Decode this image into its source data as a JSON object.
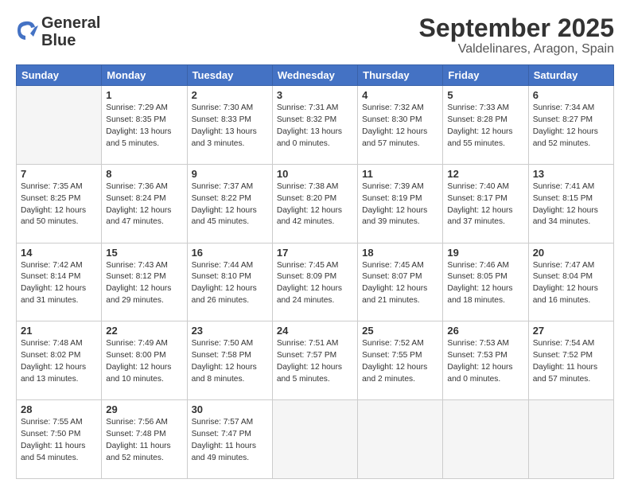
{
  "logo": {
    "line1": "General",
    "line2": "Blue"
  },
  "title": "September 2025",
  "subtitle": "Valdelinares, Aragon, Spain",
  "weekdays": [
    "Sunday",
    "Monday",
    "Tuesday",
    "Wednesday",
    "Thursday",
    "Friday",
    "Saturday"
  ],
  "weeks": [
    [
      {
        "day": "",
        "info": ""
      },
      {
        "day": "1",
        "info": "Sunrise: 7:29 AM\nSunset: 8:35 PM\nDaylight: 13 hours\nand 5 minutes."
      },
      {
        "day": "2",
        "info": "Sunrise: 7:30 AM\nSunset: 8:33 PM\nDaylight: 13 hours\nand 3 minutes."
      },
      {
        "day": "3",
        "info": "Sunrise: 7:31 AM\nSunset: 8:32 PM\nDaylight: 13 hours\nand 0 minutes."
      },
      {
        "day": "4",
        "info": "Sunrise: 7:32 AM\nSunset: 8:30 PM\nDaylight: 12 hours\nand 57 minutes."
      },
      {
        "day": "5",
        "info": "Sunrise: 7:33 AM\nSunset: 8:28 PM\nDaylight: 12 hours\nand 55 minutes."
      },
      {
        "day": "6",
        "info": "Sunrise: 7:34 AM\nSunset: 8:27 PM\nDaylight: 12 hours\nand 52 minutes."
      }
    ],
    [
      {
        "day": "7",
        "info": "Sunrise: 7:35 AM\nSunset: 8:25 PM\nDaylight: 12 hours\nand 50 minutes."
      },
      {
        "day": "8",
        "info": "Sunrise: 7:36 AM\nSunset: 8:24 PM\nDaylight: 12 hours\nand 47 minutes."
      },
      {
        "day": "9",
        "info": "Sunrise: 7:37 AM\nSunset: 8:22 PM\nDaylight: 12 hours\nand 45 minutes."
      },
      {
        "day": "10",
        "info": "Sunrise: 7:38 AM\nSunset: 8:20 PM\nDaylight: 12 hours\nand 42 minutes."
      },
      {
        "day": "11",
        "info": "Sunrise: 7:39 AM\nSunset: 8:19 PM\nDaylight: 12 hours\nand 39 minutes."
      },
      {
        "day": "12",
        "info": "Sunrise: 7:40 AM\nSunset: 8:17 PM\nDaylight: 12 hours\nand 37 minutes."
      },
      {
        "day": "13",
        "info": "Sunrise: 7:41 AM\nSunset: 8:15 PM\nDaylight: 12 hours\nand 34 minutes."
      }
    ],
    [
      {
        "day": "14",
        "info": "Sunrise: 7:42 AM\nSunset: 8:14 PM\nDaylight: 12 hours\nand 31 minutes."
      },
      {
        "day": "15",
        "info": "Sunrise: 7:43 AM\nSunset: 8:12 PM\nDaylight: 12 hours\nand 29 minutes."
      },
      {
        "day": "16",
        "info": "Sunrise: 7:44 AM\nSunset: 8:10 PM\nDaylight: 12 hours\nand 26 minutes."
      },
      {
        "day": "17",
        "info": "Sunrise: 7:45 AM\nSunset: 8:09 PM\nDaylight: 12 hours\nand 24 minutes."
      },
      {
        "day": "18",
        "info": "Sunrise: 7:45 AM\nSunset: 8:07 PM\nDaylight: 12 hours\nand 21 minutes."
      },
      {
        "day": "19",
        "info": "Sunrise: 7:46 AM\nSunset: 8:05 PM\nDaylight: 12 hours\nand 18 minutes."
      },
      {
        "day": "20",
        "info": "Sunrise: 7:47 AM\nSunset: 8:04 PM\nDaylight: 12 hours\nand 16 minutes."
      }
    ],
    [
      {
        "day": "21",
        "info": "Sunrise: 7:48 AM\nSunset: 8:02 PM\nDaylight: 12 hours\nand 13 minutes."
      },
      {
        "day": "22",
        "info": "Sunrise: 7:49 AM\nSunset: 8:00 PM\nDaylight: 12 hours\nand 10 minutes."
      },
      {
        "day": "23",
        "info": "Sunrise: 7:50 AM\nSunset: 7:58 PM\nDaylight: 12 hours\nand 8 minutes."
      },
      {
        "day": "24",
        "info": "Sunrise: 7:51 AM\nSunset: 7:57 PM\nDaylight: 12 hours\nand 5 minutes."
      },
      {
        "day": "25",
        "info": "Sunrise: 7:52 AM\nSunset: 7:55 PM\nDaylight: 12 hours\nand 2 minutes."
      },
      {
        "day": "26",
        "info": "Sunrise: 7:53 AM\nSunset: 7:53 PM\nDaylight: 12 hours\nand 0 minutes."
      },
      {
        "day": "27",
        "info": "Sunrise: 7:54 AM\nSunset: 7:52 PM\nDaylight: 11 hours\nand 57 minutes."
      }
    ],
    [
      {
        "day": "28",
        "info": "Sunrise: 7:55 AM\nSunset: 7:50 PM\nDaylight: 11 hours\nand 54 minutes."
      },
      {
        "day": "29",
        "info": "Sunrise: 7:56 AM\nSunset: 7:48 PM\nDaylight: 11 hours\nand 52 minutes."
      },
      {
        "day": "30",
        "info": "Sunrise: 7:57 AM\nSunset: 7:47 PM\nDaylight: 11 hours\nand 49 minutes."
      },
      {
        "day": "",
        "info": ""
      },
      {
        "day": "",
        "info": ""
      },
      {
        "day": "",
        "info": ""
      },
      {
        "day": "",
        "info": ""
      }
    ]
  ]
}
